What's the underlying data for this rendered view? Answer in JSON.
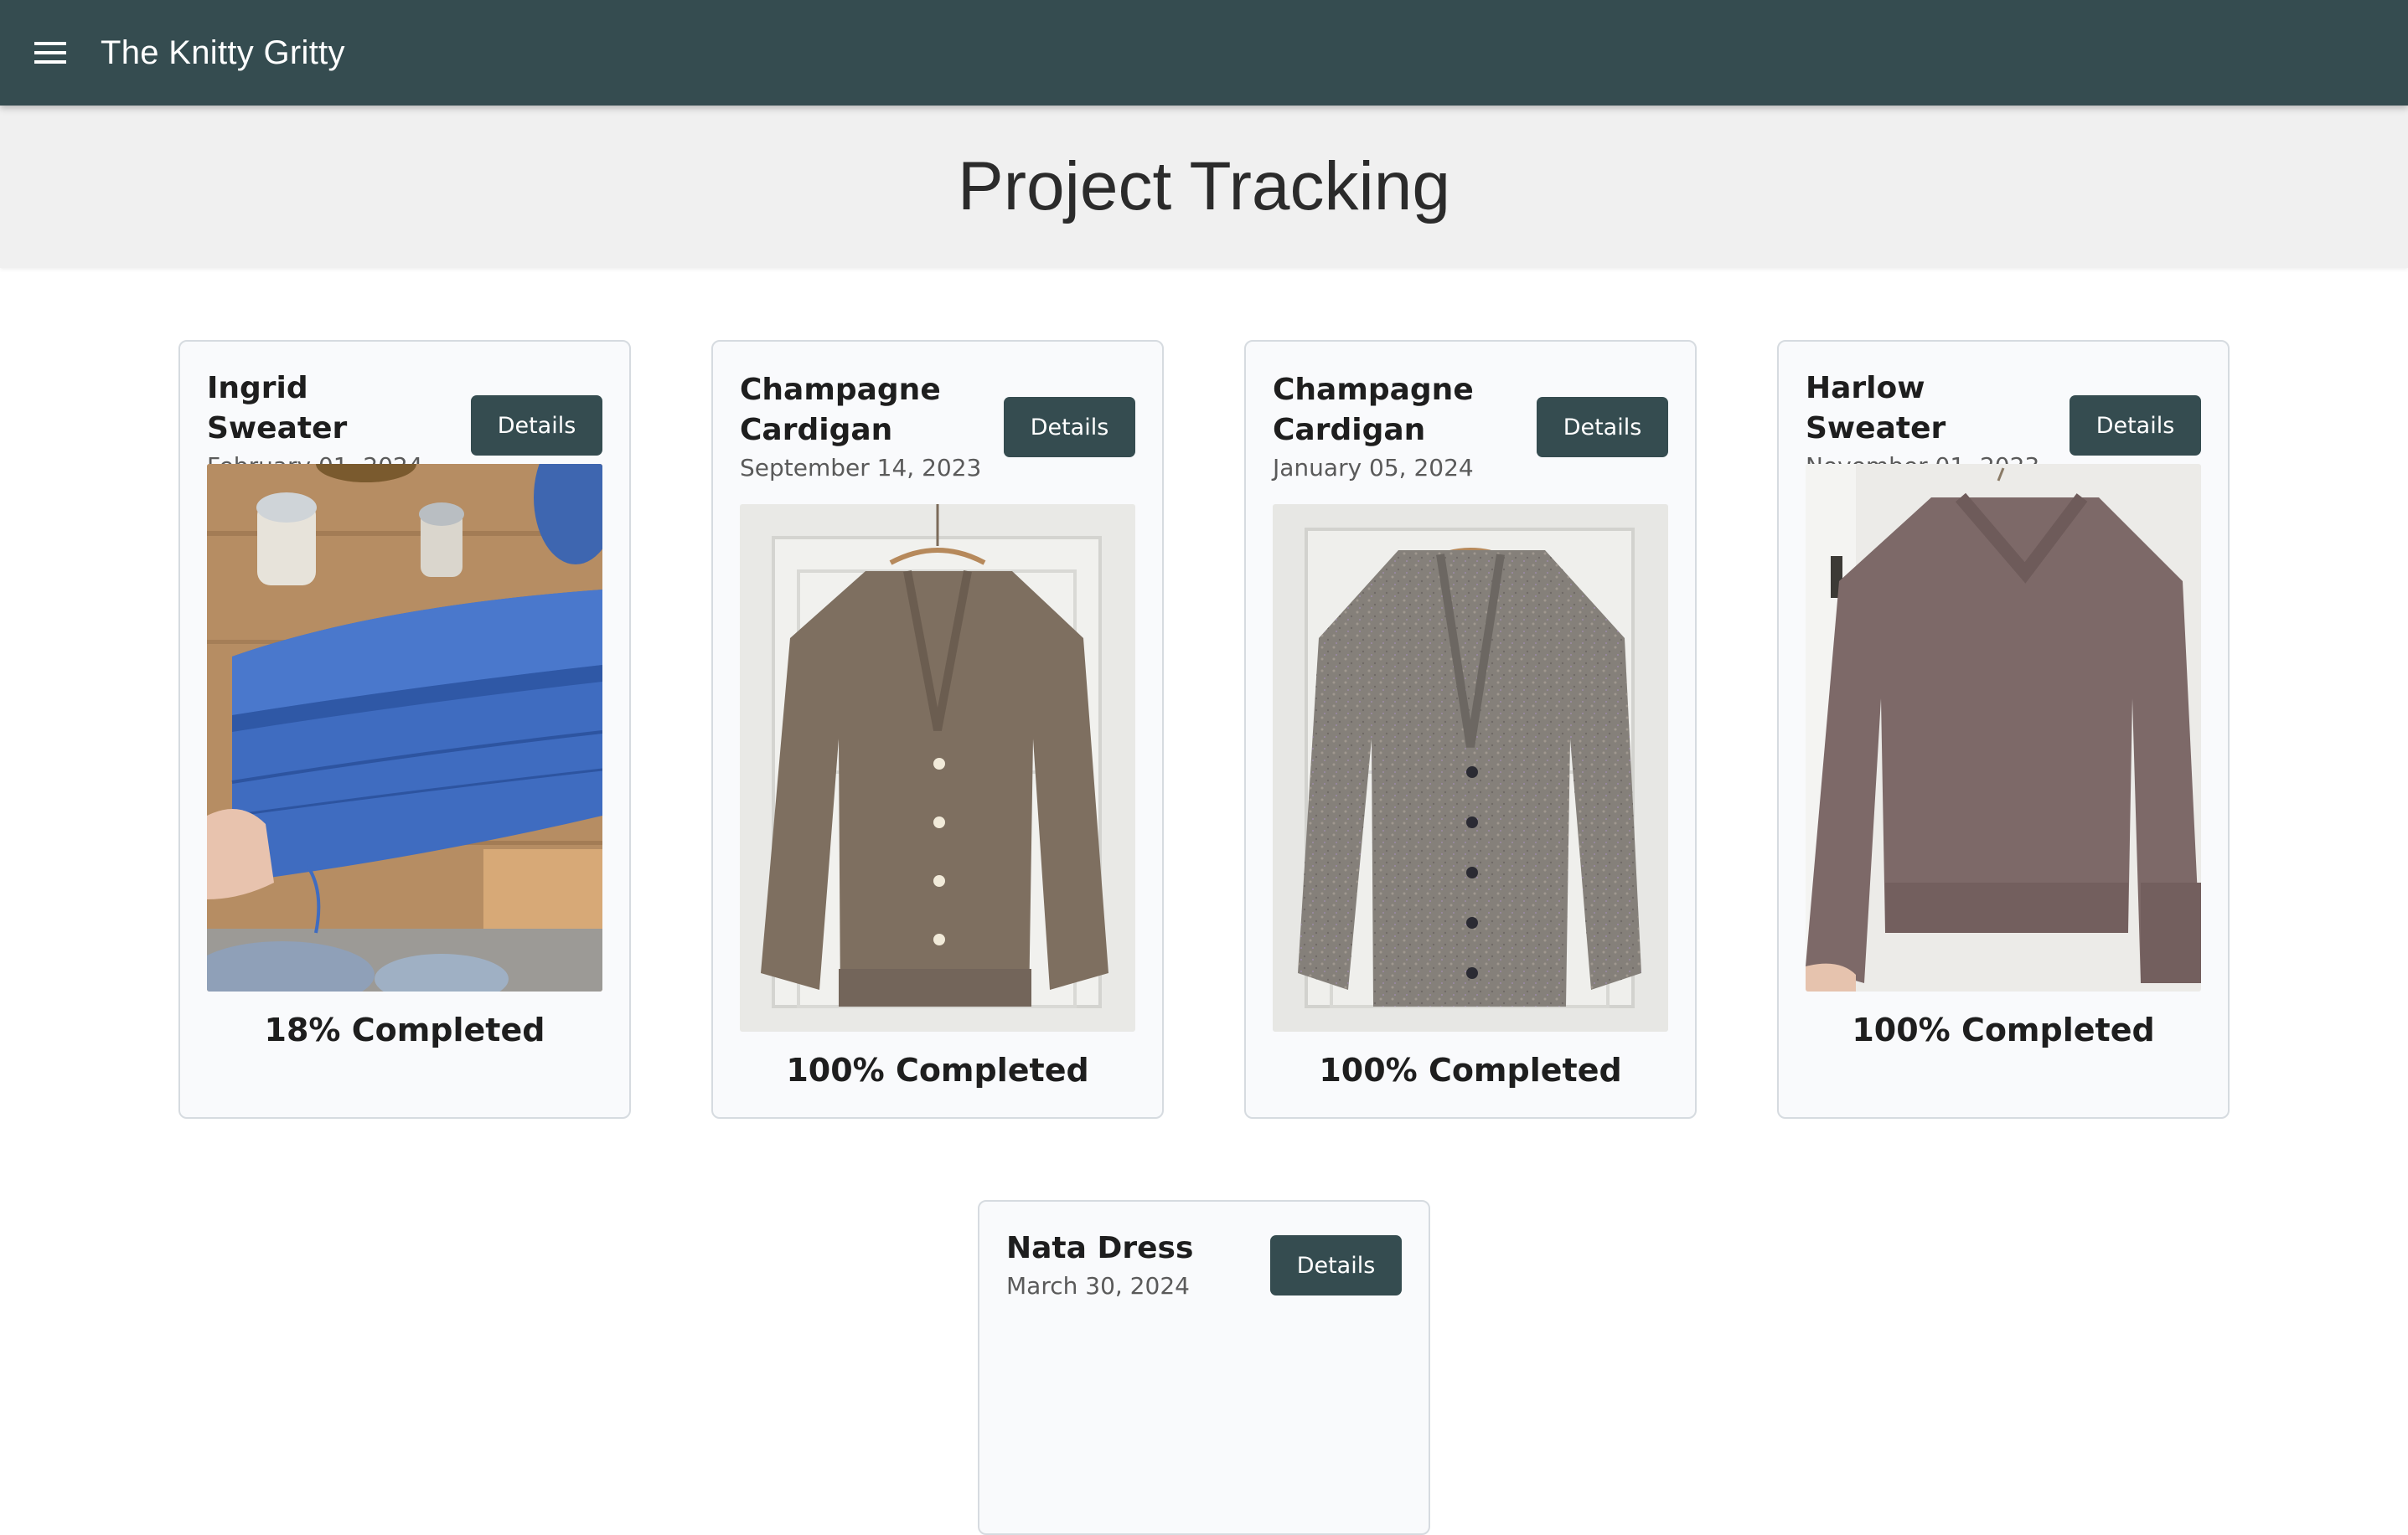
{
  "appbar": {
    "menu_icon": "hamburger-menu-icon",
    "title": "The Knitty Gritty"
  },
  "header": {
    "title": "Project Tracking"
  },
  "projects": [
    {
      "name": "Ingrid Sweater",
      "date": "February 01, 2024",
      "button_label": "Details",
      "progress_text": "18% Completed",
      "progress": 18,
      "photo": "blue knitted sweater in progress on wooden table"
    },
    {
      "name": "Champagne Cardigan",
      "date": "September 14, 2023",
      "button_label": "Details",
      "progress_text": "100% Completed",
      "progress": 100,
      "photo": "taupe cardigan on hanger"
    },
    {
      "name": "Champagne Cardigan",
      "date": "January 05, 2024",
      "button_label": "Details",
      "progress_text": "100% Completed",
      "progress": 100,
      "photo": "speckled grey cardigan on hanger"
    },
    {
      "name": "Harlow Sweater",
      "date": "November 01, 2023",
      "button_label": "Details",
      "progress_text": "100% Completed",
      "progress": 100,
      "photo": "mauve v-neck sweater on hanger"
    },
    {
      "name": "Nata Dress",
      "date": "March 30, 2024",
      "button_label": "Details"
    }
  ],
  "colors": {
    "primary": "#354c50",
    "header_bg": "#f0f0f0",
    "card_bg": "#f9fafc",
    "card_border": "#d6dbe0"
  }
}
